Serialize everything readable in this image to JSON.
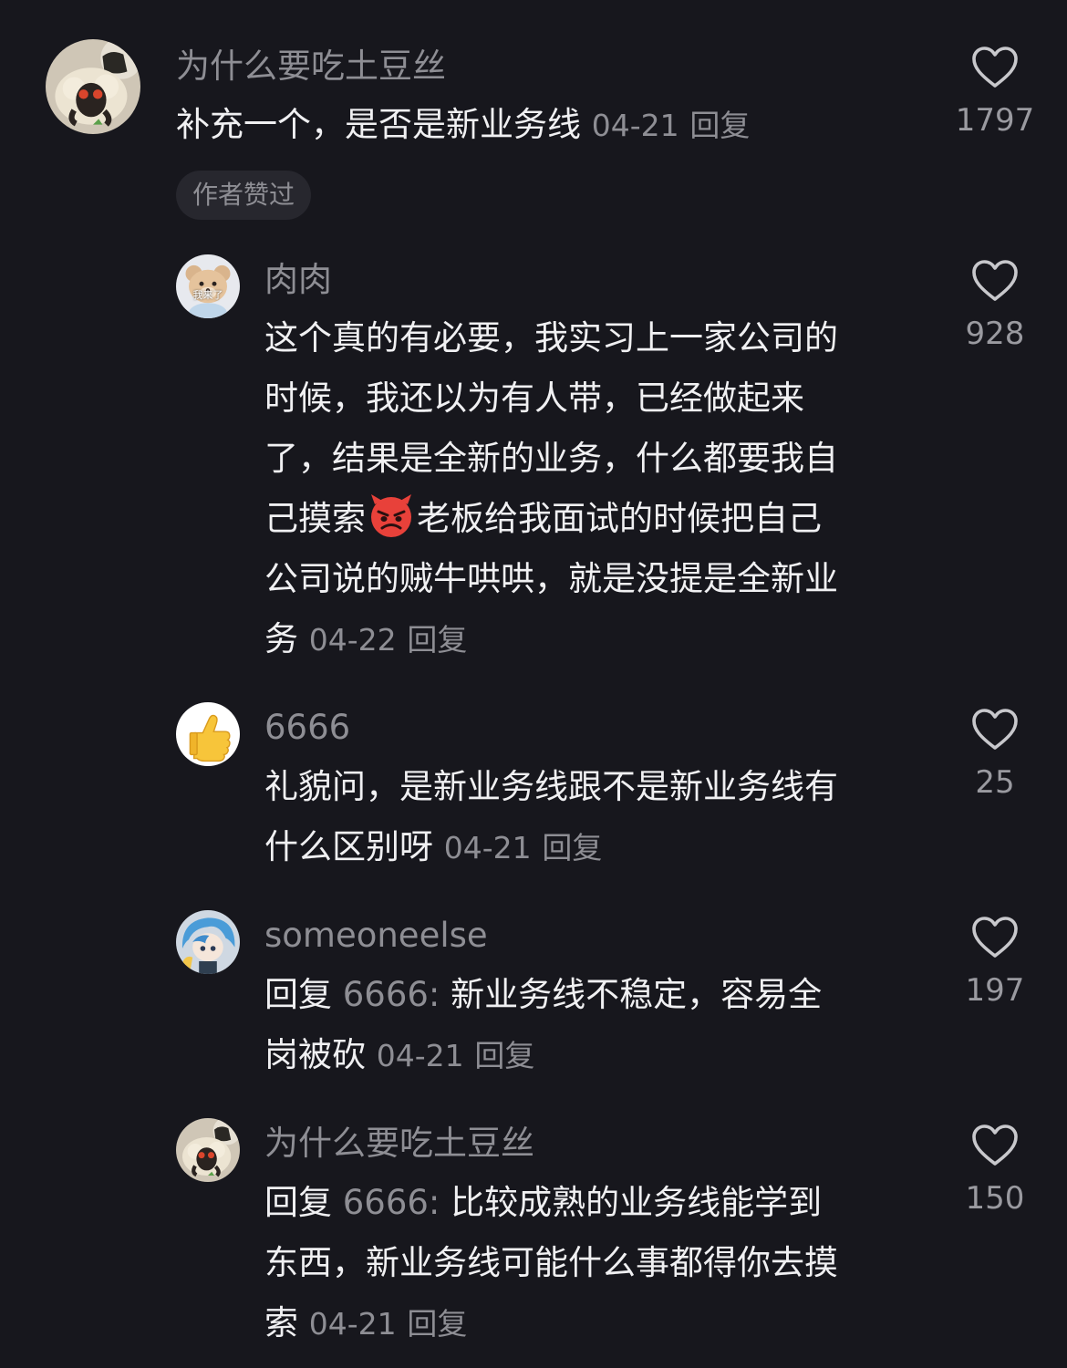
{
  "colors": {
    "background": "#17171d",
    "primary_text": "#f0f0f2",
    "secondary_text": "#8e8e94",
    "badge_bg": "#27272e"
  },
  "main_comment": {
    "username": "为什么要吃土豆丝",
    "text": "补充一个，是否是新业务线",
    "date": "04-21",
    "reply_label": "回复",
    "likes": "1797",
    "badge": "作者赞过",
    "avatar_icon": "sheep-avatar"
  },
  "replies": [
    {
      "username": "肉肉",
      "avatar_icon": "teddy-bear-avatar",
      "avatar_caption": "我来了",
      "lines": [
        "这个真的有必要，我实习上一家公司的",
        "时候，我还以为有人带，已经做起来",
        "了，结果是全新的业务，什么都要我自"
      ],
      "line4_before_emoji": "己摸索",
      "emoji": "angry-devil-emoji",
      "line4_after_emoji": "老板给我面试的时候把自己",
      "line5": "公司说的贼牛哄哄，就是没提是全新业",
      "last_line": "务",
      "date": "04-22",
      "reply_label": "回复",
      "likes": "928"
    },
    {
      "username": "6666",
      "avatar_icon": "thumbs-up-avatar",
      "lines": [
        "礼貌问，是新业务线跟不是新业务线有"
      ],
      "last_line": "什么区别呀",
      "date": "04-21",
      "reply_label": "回复",
      "likes": "25"
    },
    {
      "username": "someoneelse",
      "avatar_icon": "anime-character-avatar",
      "reply_prefix": "回复",
      "reply_to": "6666:",
      "line1_text": "新业务线不稳定，容易全",
      "last_line": "岗被砍",
      "date": "04-21",
      "reply_label": "回复",
      "likes": "197"
    },
    {
      "username": "为什么要吃土豆丝",
      "avatar_icon": "sheep-avatar",
      "reply_prefix": "回复",
      "reply_to": "6666:",
      "line1_text": "比较成熟的业务线能学到",
      "line2": "东西，新业务线可能什么事都得你去摸",
      "last_line": "索",
      "date": "04-21",
      "reply_label": "回复",
      "likes": "150"
    }
  ]
}
